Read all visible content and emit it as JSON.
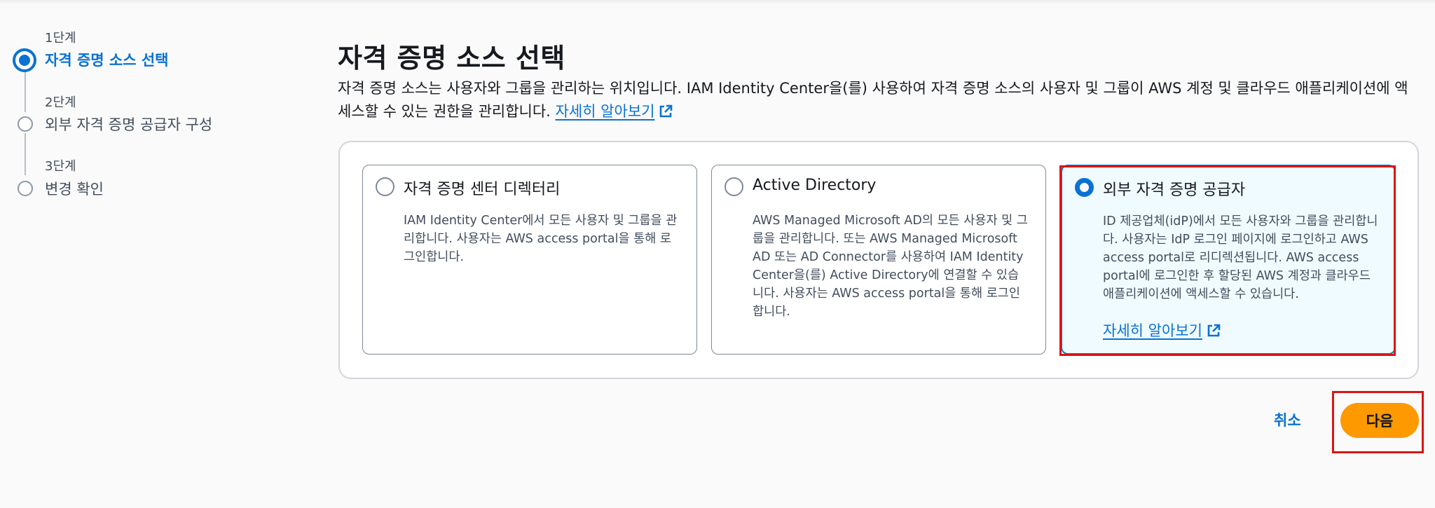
{
  "steps": [
    {
      "num": "1단계",
      "title": "자격 증명 소스 선택",
      "active": true
    },
    {
      "num": "2단계",
      "title": "외부 자격 증명 공급자 구성",
      "active": false
    },
    {
      "num": "3단계",
      "title": "변경 확인",
      "active": false
    }
  ],
  "page": {
    "title": "자격 증명 소스 선택",
    "description": "자격 증명 소스는 사용자와 그룹을 관리하는 위치입니다. IAM Identity Center을(를) 사용하여 자격 증명 소스의 사용자 및 그룹이 AWS 계정 및 클라우드 애플리케이션에 액세스할 수 있는 권한을 관리합니다.",
    "learn_more": "자세히 알아보기"
  },
  "options": [
    {
      "title": "자격 증명 센터 디렉터리",
      "description": "IAM Identity Center에서 모든 사용자 및 그룹을 관리합니다. 사용자는 AWS access portal을 통해 로그인합니다.",
      "selected": false
    },
    {
      "title": "Active Directory",
      "description": "AWS Managed Microsoft AD의 모든 사용자 및 그룹을 관리합니다. 또는 AWS Managed Microsoft AD 또는 AD Connector를 사용하여 IAM Identity Center을(를) Active Directory에 연결할 수 있습니다. 사용자는 AWS access portal을 통해 로그인합니다.",
      "selected": false
    },
    {
      "title": "외부 자격 증명 공급자",
      "description": "ID 제공업체(idP)에서 모든 사용자와 그룹을 관리합니다. 사용자는 IdP 로그인 페이지에 로그인하고 AWS access portal로 리디렉션됩니다. AWS access portal에 로그인한 후 할당된 AWS 계정과 클라우드 애플리케이션에 액세스할 수 있습니다.",
      "learn_more": "자세히 알아보기",
      "selected": true
    }
  ],
  "actions": {
    "cancel": "취소",
    "next": "다음"
  },
  "colors": {
    "accent": "#0972d3",
    "primary_button": "#ff9900",
    "highlight": "#d91515"
  },
  "icons": {
    "external_link": "external-link-icon"
  }
}
